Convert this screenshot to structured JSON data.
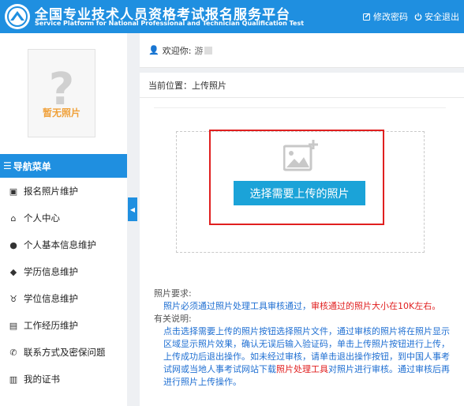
{
  "header": {
    "title": "全国专业技术人员资格考试报名服务平台",
    "subtitle": "Service Platform for National Professional and Technician Qualification Test",
    "change_password": "修改密码",
    "logout": "安全退出"
  },
  "sidebar": {
    "photo_label": "暂无照片",
    "menu_title": "导航菜单",
    "items": [
      {
        "label": "报名照片维护",
        "icon": "photo-icon"
      },
      {
        "label": "个人中心",
        "icon": "home-icon"
      },
      {
        "label": "个人基本信息维护",
        "icon": "user-icon"
      },
      {
        "label": "学历信息维护",
        "icon": "graduation-cap-icon"
      },
      {
        "label": "学位信息维护",
        "icon": "degree-icon"
      },
      {
        "label": "工作经历维护",
        "icon": "briefcase-icon"
      },
      {
        "label": "联系方式及密保问题",
        "icon": "phone-icon"
      },
      {
        "label": "我的证书",
        "icon": "certificate-icon"
      }
    ]
  },
  "welcome": {
    "text": "欢迎你:",
    "name": "游"
  },
  "main": {
    "breadcrumb": "当前位置：上传照片",
    "upload_button": "选择需要上传的照片",
    "requirements_title": "照片要求:",
    "requirements_text": "照片必须通过照片处理工具审核通过，",
    "requirements_red": "审核通过的照片大小在10K左右。",
    "notes_title": "有关说明:",
    "notes_text_1": "点击选择需要上传的照片按钮选择照片文件，通过审核的照片将在照片显示区域显示照片效果，确认无误后输入验证码，单击上传照片按钮进行上传，上传成功后退出操作。如未经过审核，请单击退出操作按钮，到中国人事考试网或当地人事考试网站下载",
    "notes_red": "照片处理工具",
    "notes_text_2": "对照片进行审核。通过审核后再进行照片上传操作。"
  },
  "colors": {
    "primary": "#1f8fe0",
    "button": "#1ba3d8",
    "highlight": "#e01f1f",
    "note_text": "#1f6fd2"
  }
}
